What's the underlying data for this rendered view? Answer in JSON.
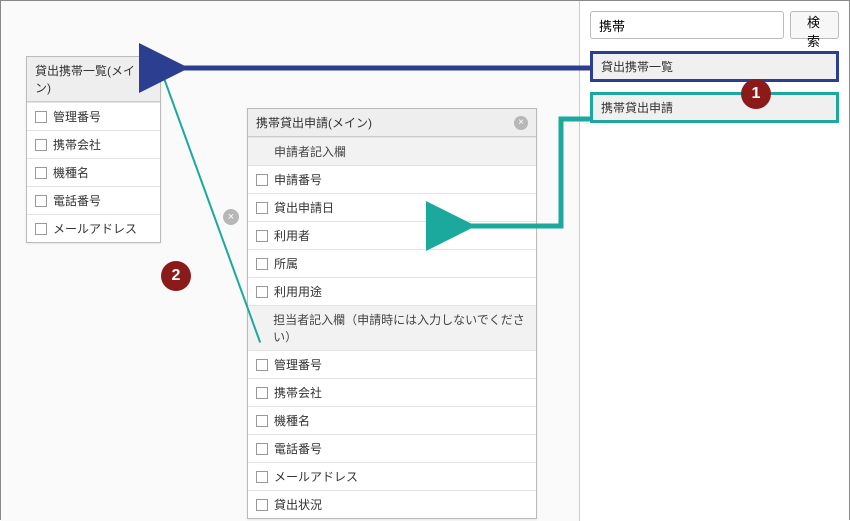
{
  "search": {
    "value": "携帯",
    "button_label": "検 索"
  },
  "results": [
    {
      "label": "貸出携帯一覧"
    },
    {
      "label": "携帯貸出申請"
    }
  ],
  "panel_left": {
    "title": "貸出携帯一覧(メイン)",
    "rows": [
      "管理番号",
      "携帯会社",
      "機種名",
      "電話番号",
      "メールアドレス"
    ]
  },
  "panel_right": {
    "title": "携帯貸出申請(メイン)",
    "sections": [
      {
        "header": "申請者記入欄",
        "rows": [
          "申請番号",
          "貸出申請日",
          "利用者",
          "所属",
          "利用用途"
        ]
      },
      {
        "header": "担当者記入欄（申請時には入力しないでください）",
        "rows": [
          "管理番号",
          "携帯会社",
          "機種名",
          "電話番号",
          "メールアドレス",
          "貸出状況"
        ]
      }
    ]
  },
  "badges": {
    "one": "1",
    "two": "2"
  },
  "colors": {
    "blue": "#2c3e8f",
    "teal": "#1aa99c",
    "badge": "#8b1a1a"
  }
}
